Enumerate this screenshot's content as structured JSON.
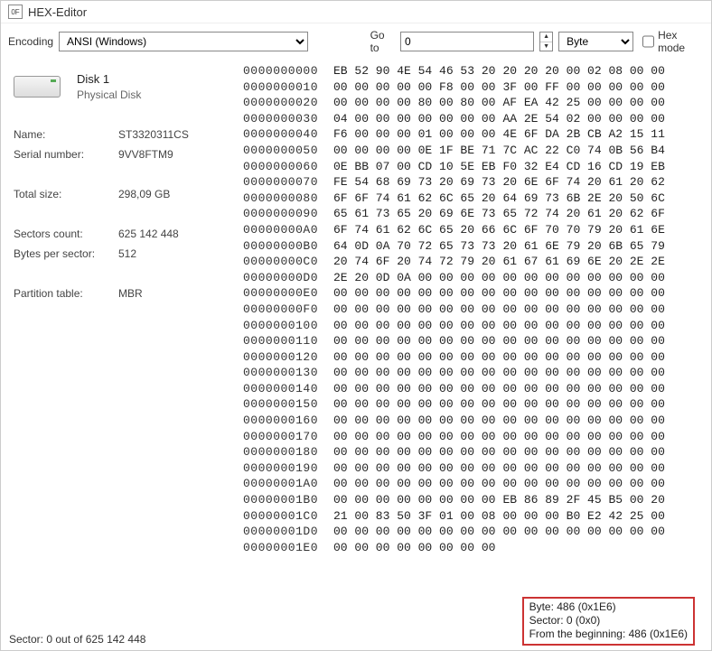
{
  "window": {
    "title": "HEX-Editor"
  },
  "toolbar": {
    "encoding_label": "Encoding",
    "encoding_value": "ANSI (Windows)",
    "goto_label": "Go to",
    "goto_value": "0",
    "unit_value": "Byte",
    "hexmode_label": "Hex mode"
  },
  "disk": {
    "name": "Disk 1",
    "type": "Physical Disk",
    "props": [
      {
        "k": "Name:",
        "v": "ST3320311CS"
      },
      {
        "k": "Serial number:",
        "v": "9VV8FTM9"
      }
    ],
    "props2": [
      {
        "k": "Total size:",
        "v": "298,09 GB"
      }
    ],
    "props3": [
      {
        "k": "Sectors count:",
        "v": "625 142 448"
      },
      {
        "k": "Bytes per sector:",
        "v": "512"
      }
    ],
    "props4": [
      {
        "k": "Partition table:",
        "v": "MBR"
      }
    ]
  },
  "hex": {
    "rows": [
      {
        "off": "0000000000",
        "a": "EB 52 90 4E 54 46 53 20",
        "b": "20 20 20 00 02 08 00 00"
      },
      {
        "off": "0000000010",
        "a": "00 00 00 00 00 F8 00 00",
        "b": "3F 00 FF 00 00 00 00 00"
      },
      {
        "off": "0000000020",
        "a": "00 00 00 00 80 00 80 00",
        "b": "AF EA 42 25 00 00 00 00"
      },
      {
        "off": "0000000030",
        "a": "04 00 00 00 00 00 00 00",
        "b": "AA 2E 54 02 00 00 00 00"
      },
      {
        "off": "0000000040",
        "a": "F6 00 00 00 01 00 00 00",
        "b": "4E 6F DA 2B CB A2 15 11"
      },
      {
        "off": "0000000050",
        "a": "00 00 00 00 0E 1F BE 71",
        "b": "7C AC 22 C0 74 0B 56 B4"
      },
      {
        "off": "0000000060",
        "a": "0E BB 07 00 CD 10 5E EB",
        "b": "F0 32 E4 CD 16 CD 19 EB"
      },
      {
        "off": "0000000070",
        "a": "FE 54 68 69 73 20 69 73",
        "b": "20 6E 6F 74 20 61 20 62"
      },
      {
        "off": "0000000080",
        "a": "6F 6F 74 61 62 6C 65 20",
        "b": "64 69 73 6B 2E 20 50 6C"
      },
      {
        "off": "0000000090",
        "a": "65 61 73 65 20 69 6E 73",
        "b": "65 72 74 20 61 20 62 6F"
      },
      {
        "off": "00000000A0",
        "a": "6F 74 61 62 6C 65 20 66",
        "b": "6C 6F 70 70 79 20 61 6E"
      },
      {
        "off": "00000000B0",
        "a": "64 0D 0A 70 72 65 73 73",
        "b": "20 61 6E 79 20 6B 65 79"
      },
      {
        "off": "00000000C0",
        "a": "20 74 6F 20 74 72 79 20",
        "b": "61 67 61 69 6E 20 2E 2E"
      },
      {
        "off": "00000000D0",
        "a": "2E 20 0D 0A 00 00 00 00",
        "b": "00 00 00 00 00 00 00 00"
      },
      {
        "off": "00000000E0",
        "a": "00 00 00 00 00 00 00 00",
        "b": "00 00 00 00 00 00 00 00"
      },
      {
        "off": "00000000F0",
        "a": "00 00 00 00 00 00 00 00",
        "b": "00 00 00 00 00 00 00 00"
      },
      {
        "off": "0000000100",
        "a": "00 00 00 00 00 00 00 00",
        "b": "00 00 00 00 00 00 00 00"
      },
      {
        "off": "0000000110",
        "a": "00 00 00 00 00 00 00 00",
        "b": "00 00 00 00 00 00 00 00"
      },
      {
        "off": "0000000120",
        "a": "00 00 00 00 00 00 00 00",
        "b": "00 00 00 00 00 00 00 00"
      },
      {
        "off": "0000000130",
        "a": "00 00 00 00 00 00 00 00",
        "b": "00 00 00 00 00 00 00 00"
      },
      {
        "off": "0000000140",
        "a": "00 00 00 00 00 00 00 00",
        "b": "00 00 00 00 00 00 00 00"
      },
      {
        "off": "0000000150",
        "a": "00 00 00 00 00 00 00 00",
        "b": "00 00 00 00 00 00 00 00"
      },
      {
        "off": "0000000160",
        "a": "00 00 00 00 00 00 00 00",
        "b": "00 00 00 00 00 00 00 00"
      },
      {
        "off": "0000000170",
        "a": "00 00 00 00 00 00 00 00",
        "b": "00 00 00 00 00 00 00 00"
      },
      {
        "off": "0000000180",
        "a": "00 00 00 00 00 00 00 00",
        "b": "00 00 00 00 00 00 00 00"
      },
      {
        "off": "0000000190",
        "a": "00 00 00 00 00 00 00 00",
        "b": "00 00 00 00 00 00 00 00"
      },
      {
        "off": "00000001A0",
        "a": "00 00 00 00 00 00 00 00",
        "b": "00 00 00 00 00 00 00 00"
      },
      {
        "off": "00000001B0",
        "a": "00 00 00 00 00 00 00 00",
        "b": "EB 86 89 2F 45 B5 00 20"
      },
      {
        "off": "00000001C0",
        "a": "21 00 83 50 3F 01 00 08",
        "b": "00 00 00 B0 E2 42 25 00"
      },
      {
        "off": "00000001D0",
        "a": "00 00 00 00 00 00 00 00",
        "b": "00 00 00 00 00 00 00 00"
      },
      {
        "off": "00000001E0",
        "a": "00 00 00 00 00 00 00 00",
        "b": "                       "
      }
    ]
  },
  "tooltip": {
    "l1": "Byte: 486 (0x1E6)",
    "l2": "Sector: 0 (0x0)",
    "l3": "From the beginning: 486 (0x1E6)"
  },
  "status": {
    "text": "Sector: 0 out of 625 142 448"
  }
}
